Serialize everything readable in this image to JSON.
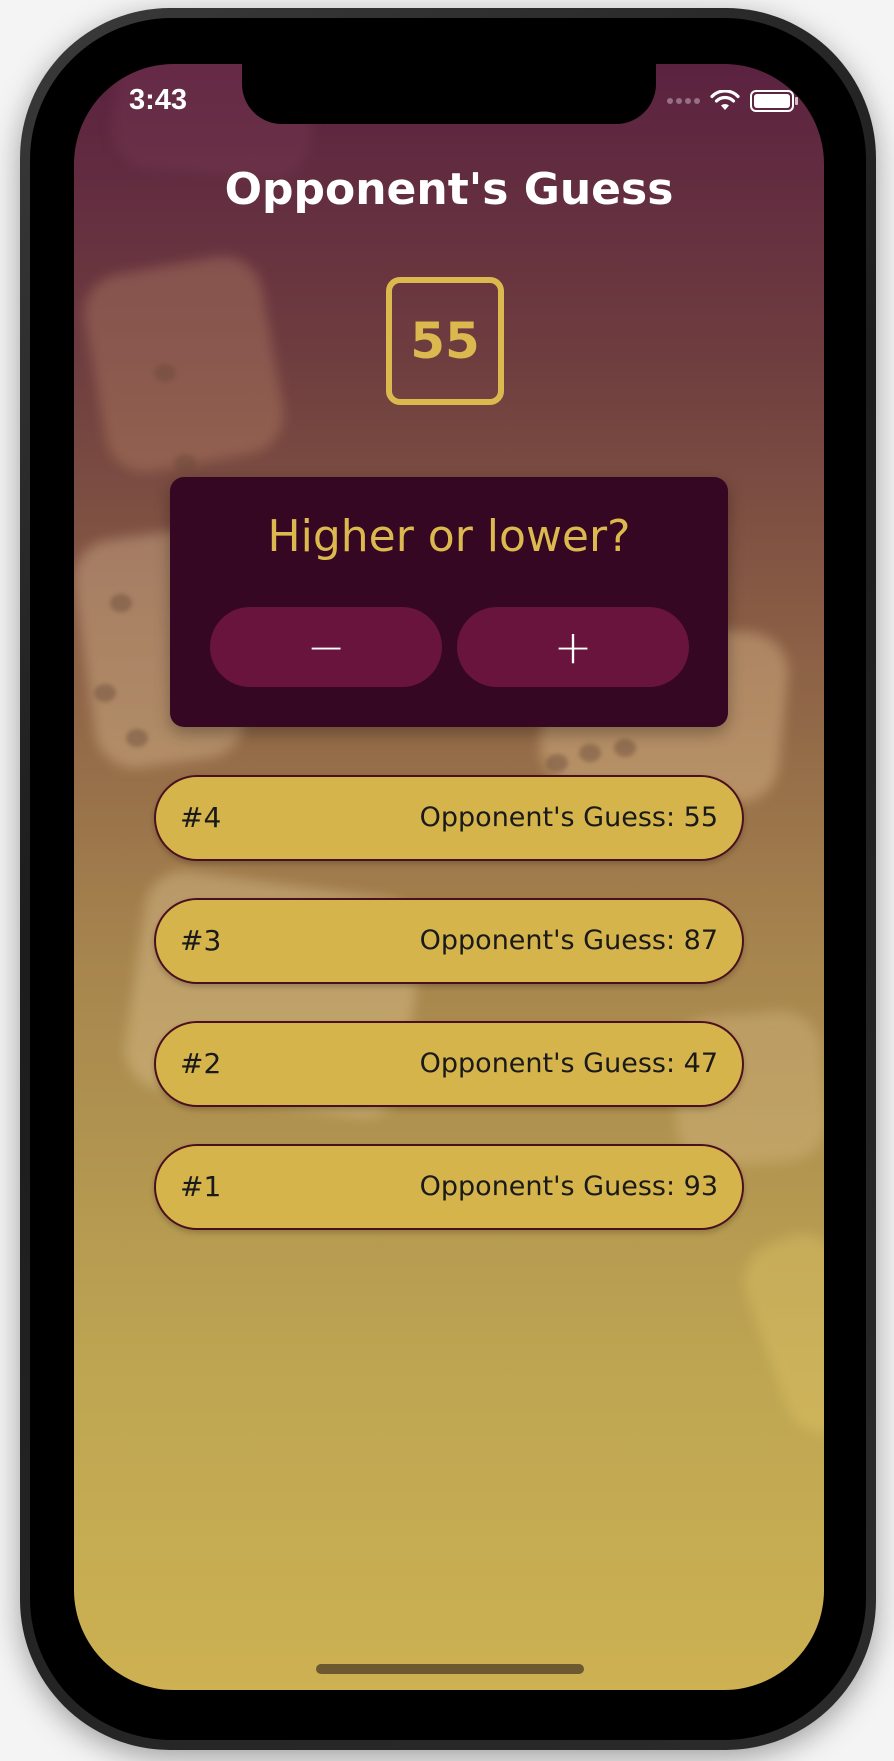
{
  "status_bar": {
    "time": "3:43",
    "icons": [
      "cellular-signal-icon",
      "wifi-icon",
      "battery-icon"
    ]
  },
  "screen": {
    "title": "Opponent's Guess",
    "current_guess": "55",
    "card": {
      "prompt": "Higher or lower?",
      "lower_button_label": "−",
      "higher_button_label": "+"
    },
    "guesses": [
      {
        "round": "#4",
        "text": "Opponent's Guess: 55"
      },
      {
        "round": "#3",
        "text": "Opponent's Guess: 87"
      },
      {
        "round": "#2",
        "text": "Opponent's Guess: 47"
      },
      {
        "round": "#1",
        "text": "Opponent's Guess: 93"
      }
    ]
  },
  "colors": {
    "accent_gold": "#dcb94e",
    "card_background": "#360722",
    "button_background": "#69143d",
    "list_item_background": "#d6b44c",
    "list_item_border": "#4a1020"
  }
}
